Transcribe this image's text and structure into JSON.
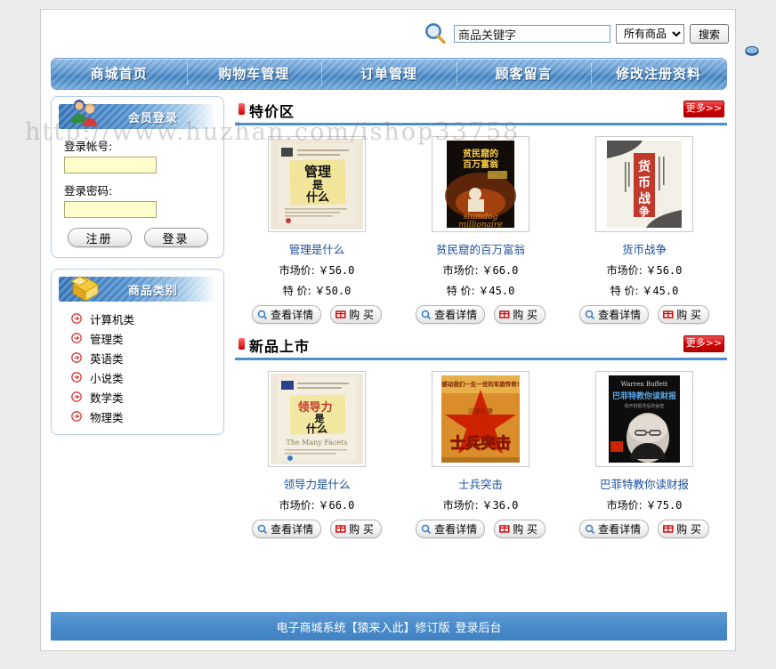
{
  "meta": {
    "watermark": "http://www.huzhan.com/ishop33758"
  },
  "search": {
    "icon": "magnifier-icon",
    "value": "商品关键字",
    "placeholder": "商品关键字",
    "scope_selected": "所有商品",
    "scope_options": [
      "所有商品"
    ],
    "button_label": "搜索"
  },
  "nav": {
    "items": [
      {
        "label": "商城首页"
      },
      {
        "label": "购物车管理"
      },
      {
        "label": "订单管理"
      },
      {
        "label": "顾客留言"
      },
      {
        "label": "修改注册资料"
      }
    ]
  },
  "sidebar": {
    "login_panel": {
      "title": "会员登录",
      "icon": "users-icon",
      "account_label": "登录帐号:",
      "account_value": "",
      "password_label": "登录密码:",
      "password_value": "",
      "register_label": "注册",
      "login_label": "登录"
    },
    "category_panel": {
      "title": "商品类别",
      "icon": "open-box-icon",
      "items": [
        {
          "label": "计算机类"
        },
        {
          "label": "管理类"
        },
        {
          "label": "英语类"
        },
        {
          "label": "小说类"
        },
        {
          "label": "数学类"
        },
        {
          "label": "物理类"
        }
      ]
    }
  },
  "sections": [
    {
      "title": "特价区",
      "more_label": "更多>>",
      "products": [
        {
          "name": "管理是什么",
          "cover": "guanli-cover",
          "market_label": "市场价:",
          "market_price": "￥56.0",
          "special_label": "特 价:",
          "special_price": "￥50.0",
          "detail_label": "查看详情",
          "buy_label": "购 买"
        },
        {
          "name": "贫民窟的百万富翁",
          "cover": "slumdog-cover",
          "market_label": "市场价:",
          "market_price": "￥66.0",
          "special_label": "特 价:",
          "special_price": "￥45.0",
          "detail_label": "查看详情",
          "buy_label": "购 买"
        },
        {
          "name": "货币战争",
          "cover": "huobi-cover",
          "market_label": "市场价:",
          "market_price": "￥56.0",
          "special_label": "特 价:",
          "special_price": "￥45.0",
          "detail_label": "查看详情",
          "buy_label": "购 买"
        }
      ]
    },
    {
      "title": "新品上市",
      "more_label": "更多>>",
      "products": [
        {
          "name": "领导力是什么",
          "cover": "lingdaoli-cover",
          "market_label": "市场价:",
          "market_price": "￥66.0",
          "special_label": "",
          "special_price": "",
          "detail_label": "查看详情",
          "buy_label": "购 买"
        },
        {
          "name": "士兵突击",
          "cover": "shibing-cover",
          "market_label": "市场价:",
          "market_price": "￥36.0",
          "special_label": "",
          "special_price": "",
          "detail_label": "查看详情",
          "buy_label": "购 买"
        },
        {
          "name": "巴菲特教你读财报",
          "cover": "buffett-cover",
          "market_label": "市场价:",
          "market_price": "￥75.0",
          "special_label": "",
          "special_price": "",
          "detail_label": "查看详情",
          "buy_label": "购 买"
        }
      ]
    }
  ],
  "footer": {
    "text": "电子商城系统【猿来入此】修订版",
    "link_label": "登录后台"
  },
  "colors": {
    "nav_blue": "#4a8ccb",
    "accent_red": "#cc0000",
    "link_blue": "#1b4f9c",
    "field_yellow": "#ffffcc"
  }
}
